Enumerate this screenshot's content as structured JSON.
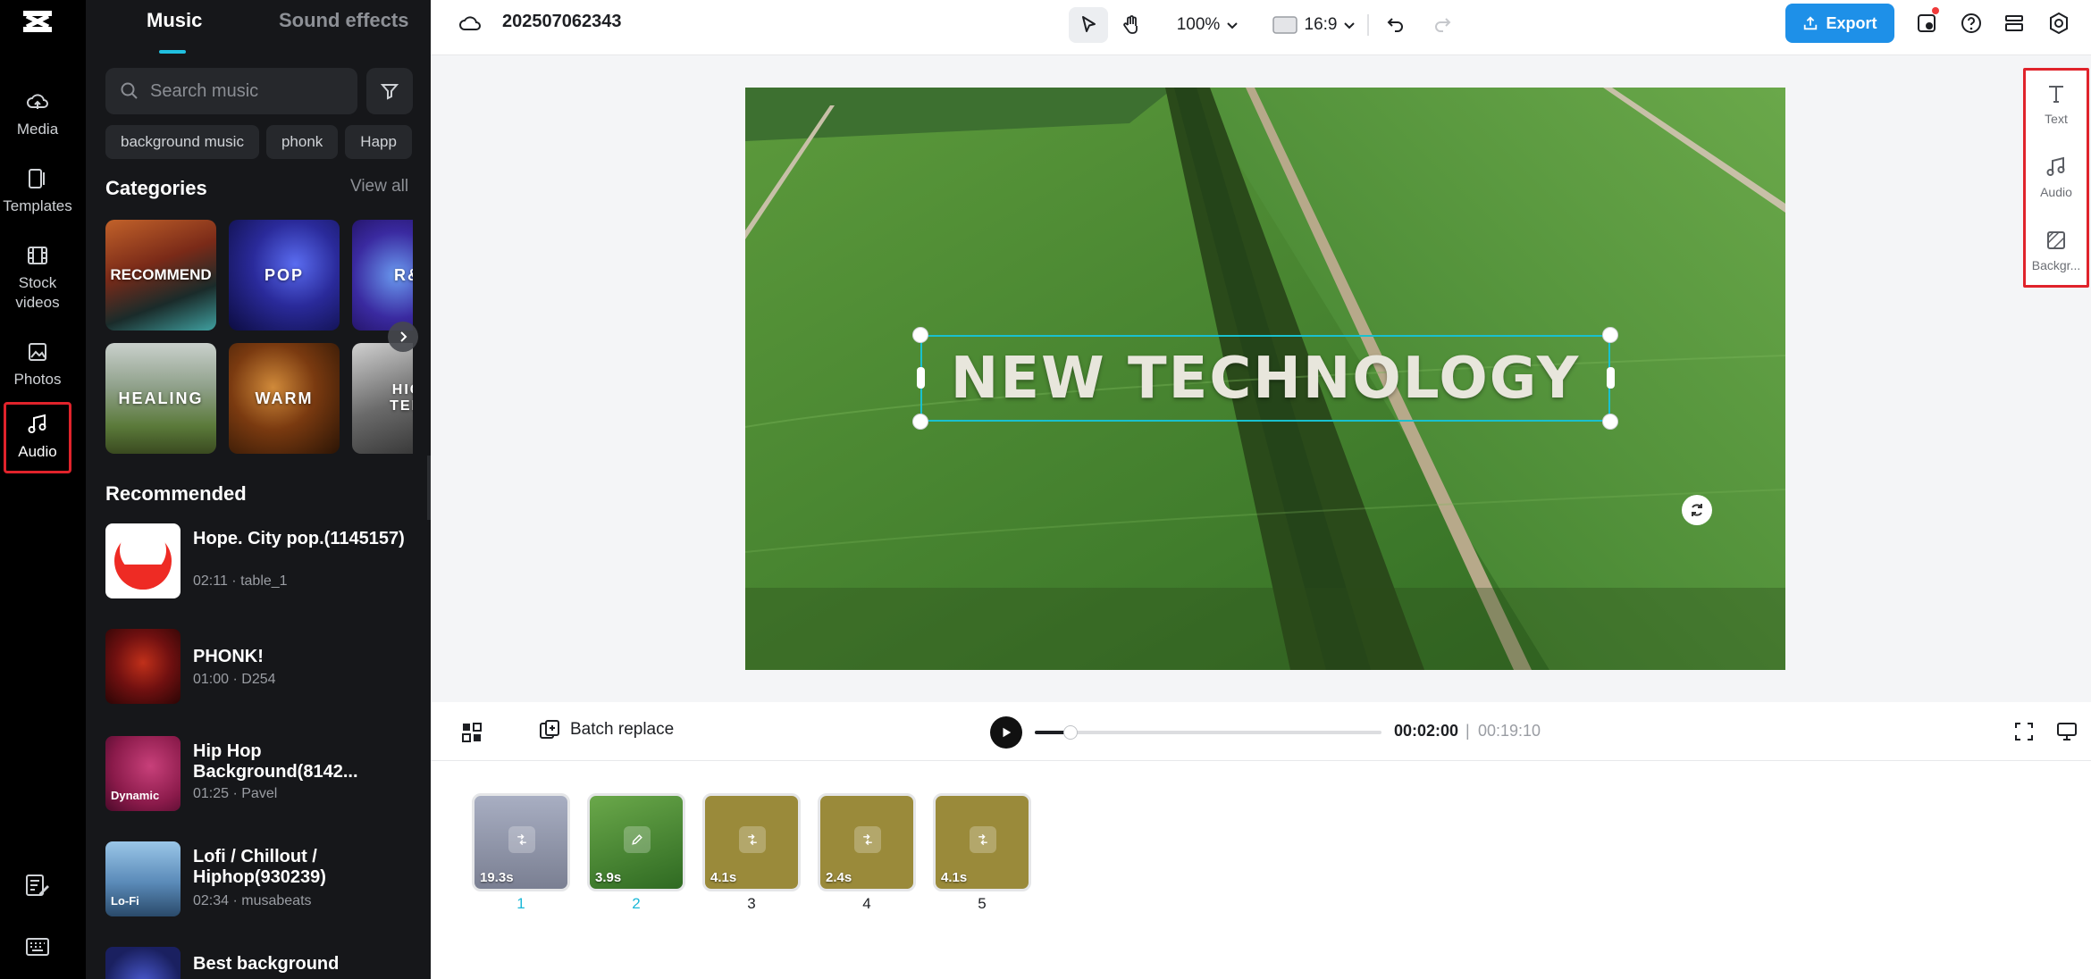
{
  "rail": {
    "items": [
      {
        "label": "Media",
        "icon": "cloud-upload-icon"
      },
      {
        "label": "Templates",
        "icon": "templates-icon"
      },
      {
        "label": "Stock videos",
        "icon": "film-icon"
      },
      {
        "label": "Photos",
        "icon": "image-icon"
      },
      {
        "label": "Audio",
        "icon": "music-note-icon",
        "active": true
      }
    ]
  },
  "panel": {
    "tabs": {
      "music": "Music",
      "sfx": "Sound effects"
    },
    "search_placeholder": "Search music",
    "chips": [
      "background music",
      "phonk",
      "Happ"
    ],
    "categories_title": "Categories",
    "view_all": "View all",
    "categories": [
      "RECOMMEND",
      "POP",
      "R&",
      "HEALING",
      "WARM",
      "HIG TEM"
    ],
    "recommended_title": "Recommended",
    "tracks": [
      {
        "title": "Hope. City pop.(1145157)",
        "meta": "02:11 · table_1"
      },
      {
        "title": "PHONK!",
        "meta": "01:00 · D254"
      },
      {
        "title": "Hip Hop Background(8142...",
        "meta": "01:25 · Pavel",
        "badge": "Dynamic"
      },
      {
        "title": "Lofi / Chillout / Hiphop(930239)",
        "meta": "02:34 · musabeats",
        "badge": "Lo-Fi"
      },
      {
        "title": "Best background",
        "meta": ""
      }
    ]
  },
  "topbar": {
    "project_name": "202507062343",
    "zoom": "100%",
    "ratio": "16:9",
    "export": "Export"
  },
  "canvas": {
    "overlay_text": "NEW TECHNOLOGY"
  },
  "right_tools": [
    {
      "label": "Text",
      "icon": "text-icon"
    },
    {
      "label": "Audio",
      "icon": "music-note-icon"
    },
    {
      "label": "Backgr...",
      "icon": "background-icon"
    }
  ],
  "playbar": {
    "batch_replace": "Batch replace",
    "current_time": "00:02:00",
    "separator": "|",
    "total_time": "00:19:10",
    "progress": 0.104
  },
  "timeline": {
    "scenes": [
      {
        "num": "1",
        "duration": "19.3s"
      },
      {
        "num": "2",
        "duration": "3.9s"
      },
      {
        "num": "3",
        "duration": "4.1s"
      },
      {
        "num": "4",
        "duration": "2.4s"
      },
      {
        "num": "5",
        "duration": "4.1s"
      }
    ]
  }
}
